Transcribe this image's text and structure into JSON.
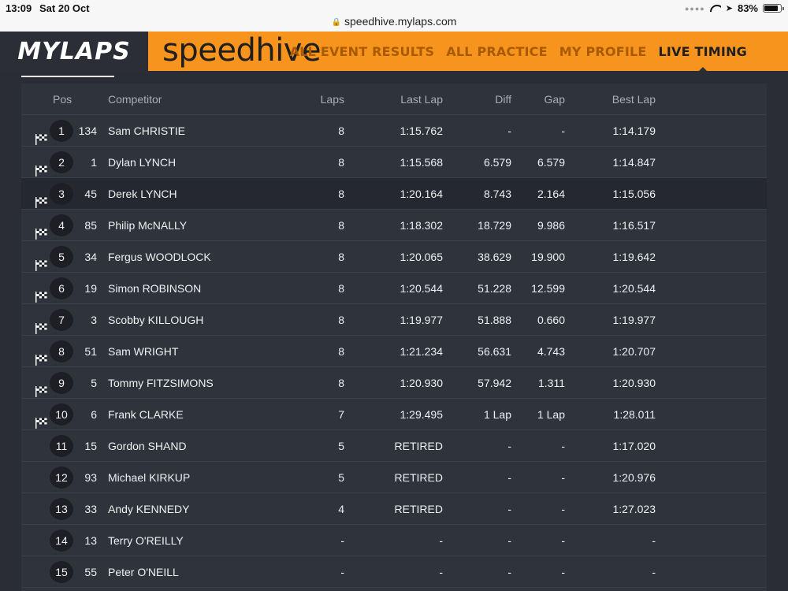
{
  "status_bar": {
    "time": "13:09",
    "date": "Sat 20 Oct",
    "url": "speedhive.mylaps.com",
    "battery": "83%",
    "battery_level": 0.83
  },
  "header": {
    "logo": "MYLAPS",
    "brand": "speedhive",
    "nav": [
      {
        "label": "ALL EVENT RESULTS",
        "active": false
      },
      {
        "label": "ALL PRACTICE",
        "active": false
      },
      {
        "label": "MY PROFILE",
        "active": false
      },
      {
        "label": "LIVE TIMING",
        "active": true
      }
    ]
  },
  "table": {
    "headers": {
      "pos": "Pos",
      "competitor": "Competitor",
      "laps": "Laps",
      "last_lap": "Last Lap",
      "diff": "Diff",
      "gap": "Gap",
      "best_lap": "Best Lap"
    },
    "rows": [
      {
        "finished": true,
        "pos": "1",
        "num": "134",
        "name": "Sam CHRISTIE",
        "laps": "8",
        "last": "1:15.762",
        "diff": "-",
        "gap": "-",
        "best": "1:14.179"
      },
      {
        "finished": true,
        "pos": "2",
        "num": "1",
        "name": "Dylan LYNCH",
        "laps": "8",
        "last": "1:15.568",
        "diff": "6.579",
        "gap": "6.579",
        "best": "1:14.847"
      },
      {
        "finished": true,
        "pos": "3",
        "num": "45",
        "name": "Derek LYNCH",
        "laps": "8",
        "last": "1:20.164",
        "diff": "8.743",
        "gap": "2.164",
        "best": "1:15.056"
      },
      {
        "finished": true,
        "pos": "4",
        "num": "85",
        "name": "Philip McNALLY",
        "laps": "8",
        "last": "1:18.302",
        "diff": "18.729",
        "gap": "9.986",
        "best": "1:16.517"
      },
      {
        "finished": true,
        "pos": "5",
        "num": "34",
        "name": "Fergus WOODLOCK",
        "laps": "8",
        "last": "1:20.065",
        "diff": "38.629",
        "gap": "19.900",
        "best": "1:19.642"
      },
      {
        "finished": true,
        "pos": "6",
        "num": "19",
        "name": "Simon ROBINSON",
        "laps": "8",
        "last": "1:20.544",
        "diff": "51.228",
        "gap": "12.599",
        "best": "1:20.544"
      },
      {
        "finished": true,
        "pos": "7",
        "num": "3",
        "name": "Scobby KILLOUGH",
        "laps": "8",
        "last": "1:19.977",
        "diff": "51.888",
        "gap": "0.660",
        "best": "1:19.977"
      },
      {
        "finished": true,
        "pos": "8",
        "num": "51",
        "name": "Sam WRIGHT",
        "laps": "8",
        "last": "1:21.234",
        "diff": "56.631",
        "gap": "4.743",
        "best": "1:20.707"
      },
      {
        "finished": true,
        "pos": "9",
        "num": "5",
        "name": "Tommy FITZSIMONS",
        "laps": "8",
        "last": "1:20.930",
        "diff": "57.942",
        "gap": "1.311",
        "best": "1:20.930"
      },
      {
        "finished": true,
        "pos": "10",
        "num": "6",
        "name": "Frank CLARKE",
        "laps": "7",
        "last": "1:29.495",
        "diff": "1 Lap",
        "gap": "1 Lap",
        "best": "1:28.011"
      },
      {
        "finished": false,
        "pos": "11",
        "num": "15",
        "name": "Gordon SHAND",
        "laps": "5",
        "last": "RETIRED",
        "diff": "-",
        "gap": "-",
        "best": "1:17.020"
      },
      {
        "finished": false,
        "pos": "12",
        "num": "93",
        "name": "Michael KIRKUP",
        "laps": "5",
        "last": "RETIRED",
        "diff": "-",
        "gap": "-",
        "best": "1:20.976"
      },
      {
        "finished": false,
        "pos": "13",
        "num": "33",
        "name": "Andy KENNEDY",
        "laps": "4",
        "last": "RETIRED",
        "diff": "-",
        "gap": "-",
        "best": "1:27.023"
      },
      {
        "finished": false,
        "pos": "14",
        "num": "13",
        "name": "Terry O'REILLY",
        "laps": "-",
        "last": "-",
        "diff": "-",
        "gap": "-",
        "best": "-"
      },
      {
        "finished": false,
        "pos": "15",
        "num": "55",
        "name": "Peter O'NEILL",
        "laps": "-",
        "last": "-",
        "diff": "-",
        "gap": "-",
        "best": "-"
      }
    ]
  }
}
